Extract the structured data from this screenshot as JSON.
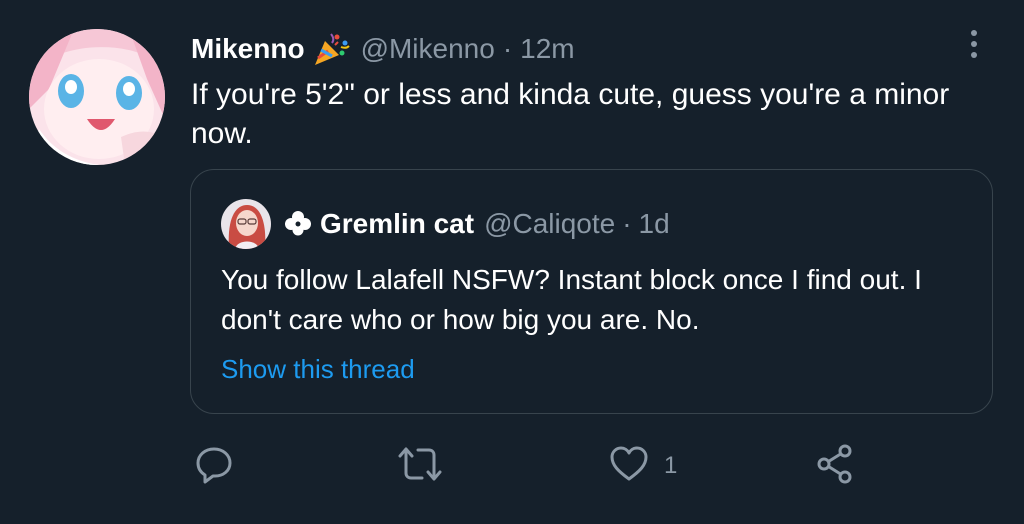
{
  "colors": {
    "background": "#15202b",
    "primary_text": "#ffffff",
    "secondary_text": "#8b98a5",
    "link": "#1d9bf0",
    "border": "#38444d"
  },
  "tweet": {
    "display_name": "Mikenno",
    "name_badge_icon": "party-popper-icon",
    "handle": "@Mikenno",
    "separator": "·",
    "time": "12m",
    "text": "If you're 5'2\" or less and kinda cute, guess you're a minor now."
  },
  "quoted_tweet": {
    "name_prefix_icon": "clover-icon",
    "display_name": "Gremlin cat",
    "handle": "@Caliqote",
    "separator": "·",
    "time": "1d",
    "text": "You follow Lalafell NSFW? Instant block once I find out. I don't care who or how big you are. No.",
    "show_thread_label": "Show this thread"
  },
  "actions": {
    "reply_icon": "reply-icon",
    "retweet_icon": "retweet-icon",
    "like_icon": "heart-icon",
    "like_count": "1",
    "share_icon": "share-icon"
  }
}
